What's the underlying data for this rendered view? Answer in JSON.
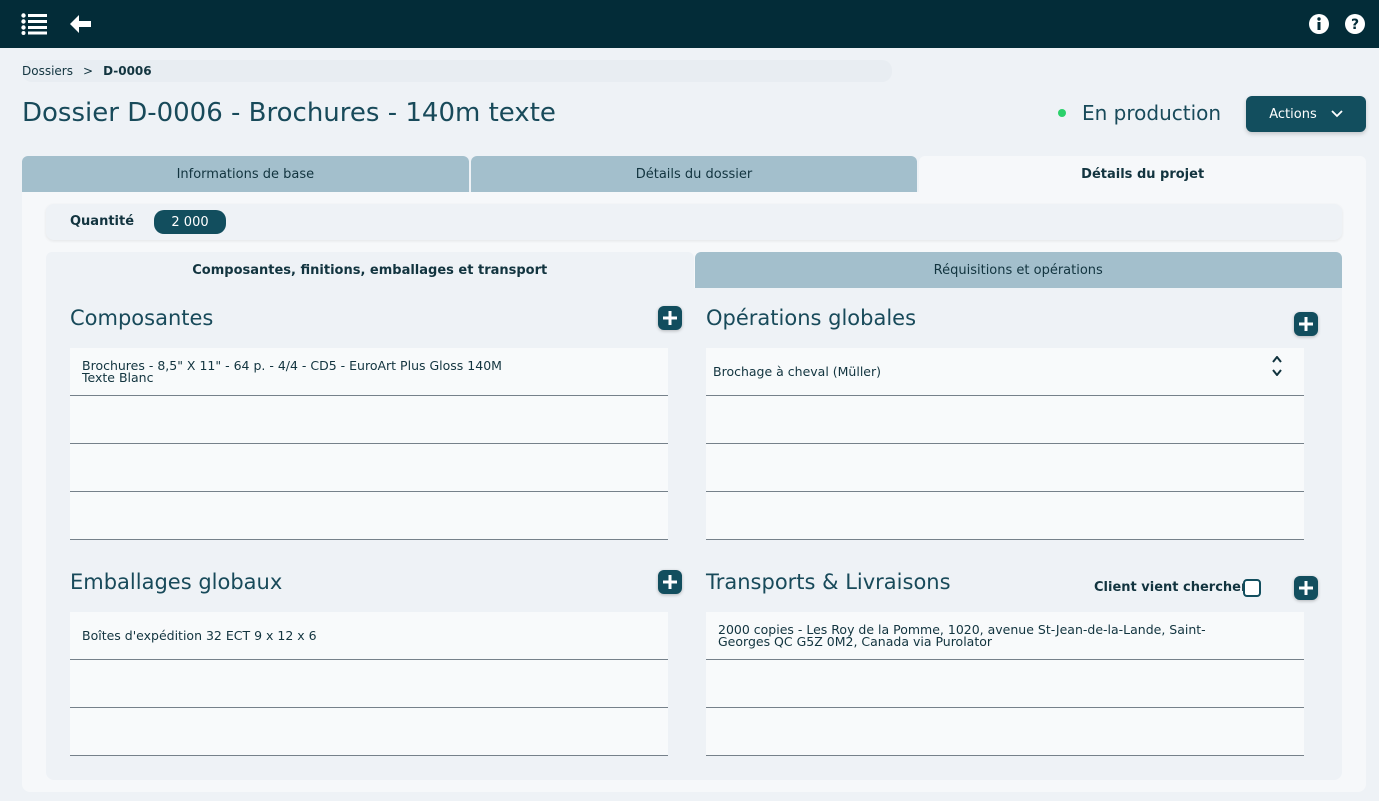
{
  "header": {
    "icons": [
      "menu-icon",
      "back-arrow-icon",
      "info-icon",
      "help-icon"
    ]
  },
  "breadcrumb": {
    "root": "Dossiers",
    "separator": ">",
    "current": "D-0006"
  },
  "page": {
    "title": "Dossier D-0006 - Brochures - 140m texte",
    "status": "En production",
    "status_color": "#2bd16b",
    "actions_label": "Actions"
  },
  "outer_tabs": [
    "Informations de base",
    "Détails du dossier",
    "Détails du projet"
  ],
  "quantity": {
    "label": "Quantité",
    "value": "2 000"
  },
  "inner_tabs": [
    "Composantes, finitions, emballages et transport",
    "Réquisitions et opérations"
  ],
  "composantes": {
    "title": "Composantes",
    "rows": [
      "Brochures - 8,5\" X 11\" - 64 p. - 4/4 - CD5 - EuroArt Plus Gloss 140M\nTexte Blanc",
      "",
      "",
      ""
    ]
  },
  "operations": {
    "title": "Opérations globales",
    "rows": [
      "Brochage à cheval (Müller)",
      "",
      "",
      ""
    ]
  },
  "emballages": {
    "title": "Emballages globaux",
    "rows": [
      "Boîtes d'expédition 32 ECT 9 x 12 x 6",
      "",
      ""
    ]
  },
  "transports": {
    "title": "Transports & Livraisons",
    "pickup_label": "Client vient chercher",
    "rows": [
      "2000 copies - Les Roy de la Pomme, 1020, avenue St-Jean-de-la-Lande, Saint-\nGeorges QC  G5Z 0M2, Canada via Purolator",
      "",
      ""
    ]
  },
  "colors": {
    "header_bg": "#032c38",
    "accent": "#124e5e",
    "tab_inactive": "#a3bfcc"
  }
}
